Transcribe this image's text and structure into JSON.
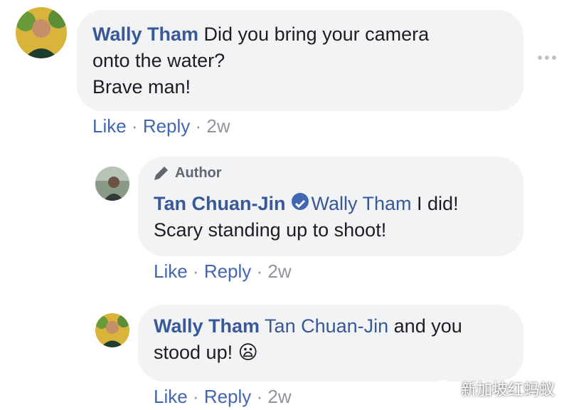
{
  "comment1": {
    "author": "Wally Tham",
    "line1": "Did you bring your camera",
    "line2": "onto the water?",
    "line3": "Brave man!",
    "actions": {
      "like": "Like",
      "sep1": " · ",
      "reply": "Reply",
      "sep2": " · ",
      "time": "2w"
    }
  },
  "reply1": {
    "badge": "Author",
    "author": "Tan Chuan-Jin",
    "mention": "Wally Tham",
    "text_after_mention": " I did!",
    "line2": "Scary standing up to shoot!",
    "actions": {
      "like": "Like",
      "sep1": " · ",
      "reply": "Reply",
      "sep2": " · ",
      "time": "2w"
    }
  },
  "reply2": {
    "author": "Wally Tham",
    "mention": "Tan Chuan-Jin",
    "text_after_mention": " and you",
    "line2": "stood up! ",
    "emoji": "😦",
    "actions": {
      "like": "Like",
      "sep1": " · ",
      "reply": "Reply",
      "sep2": " · ",
      "time": "2w"
    }
  },
  "watermark": {
    "text": "新加坡红蚂蚁"
  },
  "colors": {
    "link": "#385898",
    "bubble": "#f2f3f5",
    "meta": "#90949c",
    "action": "#4267b2"
  },
  "icons": [
    "more-dots-icon",
    "pencil-icon",
    "verified-check-icon",
    "wechat-icon"
  ]
}
